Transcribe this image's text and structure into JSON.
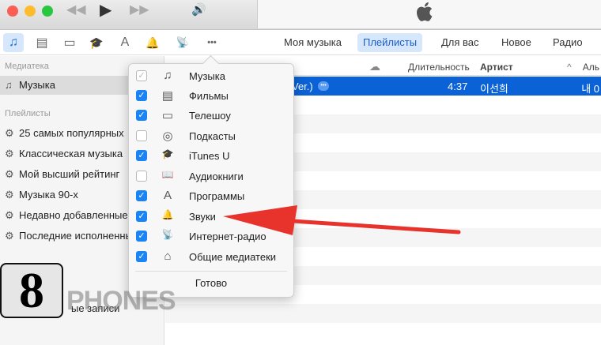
{
  "window": {
    "controls": {
      "rewind": "◀◀",
      "play": "▶",
      "forward": "▶▶",
      "volume": "🔊"
    }
  },
  "toolbar": {
    "media_icons": [
      "music-icon",
      "film-icon",
      "tv-icon",
      "itunes-u-icon",
      "apps-icon",
      "tones-icon",
      "radio-icon",
      "more-icon"
    ],
    "nav": [
      {
        "label": "Моя музыка",
        "selected": false
      },
      {
        "label": "Плейлисты",
        "selected": true
      },
      {
        "label": "Для вас",
        "selected": false
      },
      {
        "label": "Новое",
        "selected": false
      },
      {
        "label": "Радио",
        "selected": false
      }
    ]
  },
  "sidebar": {
    "library_header": "Медиатека",
    "library_item": "Музыка",
    "playlists_header": "Плейлисты",
    "playlists": [
      "25 самых популярных",
      "Классическая музыка",
      "Мой высший рейтинг",
      "Музыка 90-х",
      "Недавно добавленные",
      "Последние исполненные"
    ],
    "partial_item": "ые записи"
  },
  "table": {
    "columns": {
      "duration": "Длительность",
      "artist": "Артист",
      "album": "Аль"
    },
    "selected_row": {
      "title": "Ver.)",
      "duration": "4:37",
      "artist": "이선희",
      "album": "내 0"
    }
  },
  "popover": {
    "items": [
      {
        "label": "Музыка",
        "checked": true,
        "disabled": true,
        "icon": "♫"
      },
      {
        "label": "Фильмы",
        "checked": true,
        "icon": "▤"
      },
      {
        "label": "Телешоу",
        "checked": true,
        "icon": "▭"
      },
      {
        "label": "Подкасты",
        "checked": false,
        "icon": "◎"
      },
      {
        "label": "iTunes U",
        "checked": true,
        "icon": "🎓"
      },
      {
        "label": "Аудиокниги",
        "checked": false,
        "icon": "📖"
      },
      {
        "label": "Программы",
        "checked": true,
        "icon": "A"
      },
      {
        "label": "Звуки",
        "checked": true,
        "icon": "🔔"
      },
      {
        "label": "Интернет-радио",
        "checked": true,
        "icon": "📡"
      },
      {
        "label": "Общие медиатеки",
        "checked": true,
        "icon": "⌂"
      }
    ],
    "done": "Готово"
  },
  "overlay": {
    "step_badge": "8",
    "watermark": "PHONES",
    "arrow_color": "#e8322c"
  }
}
